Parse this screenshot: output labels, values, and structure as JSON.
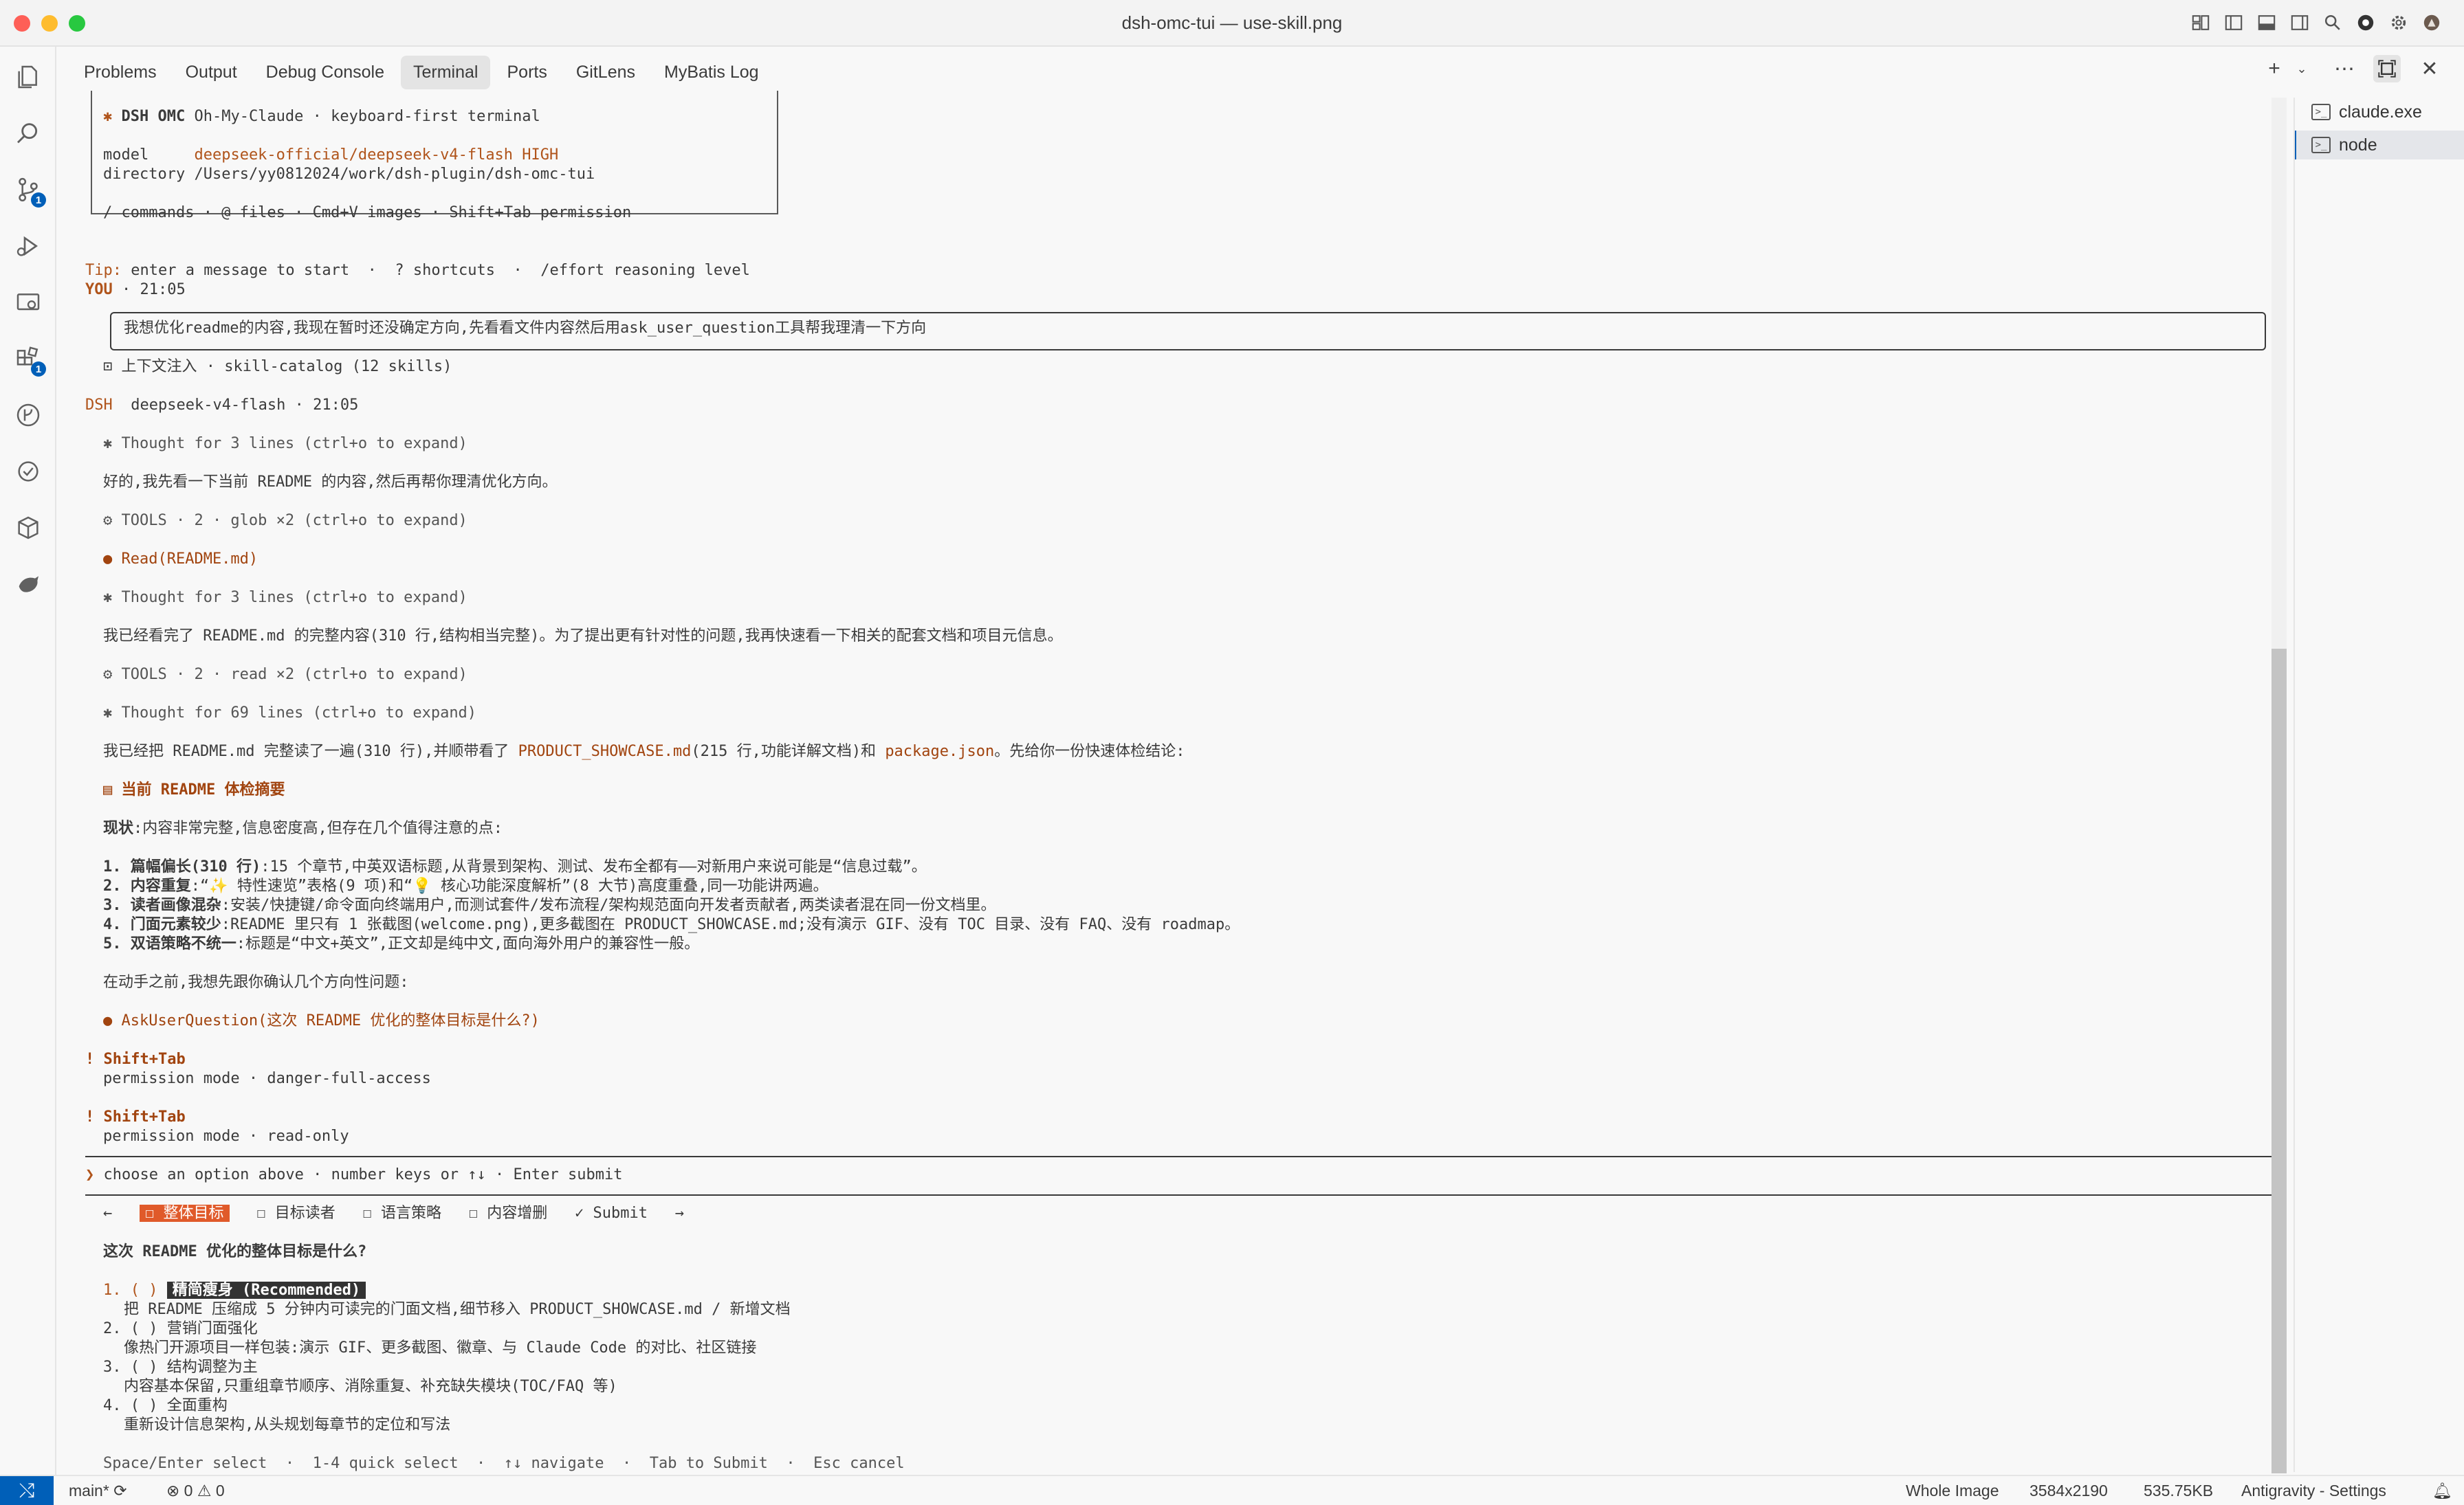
{
  "window": {
    "title": "dsh-omc-tui — use-skill.png"
  },
  "activity_bar": {
    "scm_badge": "1",
    "extensions_badge": "1"
  },
  "panel": {
    "tabs": [
      "Problems",
      "Output",
      "Debug Console",
      "Terminal",
      "Ports",
      "GitLens",
      "MyBatis Log"
    ],
    "active_tab": "Terminal"
  },
  "terminals": [
    {
      "label": "claude.exe",
      "active": false
    },
    {
      "label": "node",
      "active": true
    }
  ],
  "term": {
    "brand_star": "✱",
    "brand_name": "DSH OMC",
    "brand_sub": "Oh-My-Claude · keyboard-first terminal",
    "model_key": "model",
    "model_val": "deepseek-official/deepseek-v4-flash HIGH",
    "dir_key": "directory",
    "dir_val": "/Users/yy0812024/work/dsh-plugin/dsh-omc-tui",
    "hint": "/ commands · @ files · Cmd+V images · Shift+Tab permission",
    "tip_label": "Tip:",
    "tip_text": " enter a message to start  ·  ? shortcuts  ·  /effort reasoning level",
    "you_label": "YOU",
    "you_time": " · 21:05",
    "user_msg": "我想优化readme的内容,我现在暂时还没确定方向,先看看文件内容然后用ask_user_question工具帮我理清一下方向",
    "ctx_inject": "⊡ 上下文注入 · skill-catalog (12 skills)",
    "dsh_label": "DSH",
    "dsh_model": "  deepseek-v4-flash · 21:05",
    "thought1": "✱ Thought for 3 lines (ctrl+o to expand)",
    "resp1": "好的,我先看一下当前 README 的内容,然后再帮你理清优化方向。",
    "tools1": "⚙ TOOLS · 2 · glob ×2 (ctrl+o to expand)",
    "read_call": "● Read(README.md)",
    "thought2": "✱ Thought for 3 lines (ctrl+o to expand)",
    "resp2": "我已经看完了 README.md 的完整内容(310 行,结构相当完整)。为了提出更有针对性的问题,我再快速看一下相关的配套文档和项目元信息。",
    "tools2": "⚙ TOOLS · 2 · read ×2 (ctrl+o to expand)",
    "thought3": "✱ Thought for 69 lines (ctrl+o to expand)",
    "resp3_a": "我已经把 README.md 完整读了一遍(310 行),并顺带看了 ",
    "resp3_b": "PRODUCT_SHOWCASE.md",
    "resp3_c": "(215 行,功能详解文档)和 ",
    "resp3_d": "package.json",
    "resp3_e": "。先给你一份快速体检结论:",
    "summary_heading": "▤ 当前 README 体检摘要",
    "status_label": "现状",
    "status_text": ":内容非常完整,信息密度高,但存在几个值得注意的点:",
    "points": [
      {
        "num": "1.",
        "title": "篇幅偏长(310 行)",
        "text": ":15 个章节,中英双语标题,从背景到架构、测试、发布全都有——对新用户来说可能是“信息过载”。"
      },
      {
        "num": "2.",
        "title": "内容重复",
        "text": ":“✨ 特性速览”表格(9 项)和“💡 核心功能深度解析”(8 大节)高度重叠,同一功能讲两遍。"
      },
      {
        "num": "3.",
        "title": "读者画像混杂",
        "text": ":安装/快捷键/命令面向终端用户,而测试套件/发布流程/架构规范面向开发者贡献者,两类读者混在同一份文档里。"
      },
      {
        "num": "4.",
        "title": "门面元素较少",
        "text": ":README 里只有 1 张截图(welcome.png),更多截图在 PRODUCT_SHOWCASE.md;没有演示 GIF、没有 TOC 目录、没有 FAQ、没有 roadmap。"
      },
      {
        "num": "5.",
        "title": "双语策略不统一",
        "text": ":标题是“中文+英文”,正文却是纯中文,面向海外用户的兼容性一般。"
      }
    ],
    "pre_ask": "在动手之前,我想先跟你确认几个方向性问题:",
    "ask_call": "● AskUserQuestion(这次 README 优化的整体目标是什么?)",
    "perm1_key": "! Shift+Tab",
    "perm1_val": "permission mode · danger-full-access",
    "perm2_key": "! Shift+Tab",
    "perm2_val": "permission mode · read-only",
    "prompt_arrow": "❯",
    "prompt_text": " choose an option above · number keys or ↑↓ · Enter submit",
    "nav_left": "←",
    "q_tabs": [
      "☐ 整体目标",
      "☐ 目标读者",
      "☐ 语言策略",
      "☐ 内容增删",
      "✓ Submit"
    ],
    "nav_right": "→",
    "question": "这次 README 优化的整体目标是什么?",
    "options": [
      {
        "num": "1. ( )",
        "title": "精简瘦身 (Recommended)",
        "desc": "把 README 压缩成 5 分钟内可读完的门面文档,细节移入 PRODUCT_SHOWCASE.md / 新增文档"
      },
      {
        "num": "2. ( )",
        "title": "营销门面强化",
        "desc": "像热门开源项目一样包装:演示 GIF、更多截图、徽章、与 Claude Code 的对比、社区链接"
      },
      {
        "num": "3. ( )",
        "title": "结构调整为主",
        "desc": "内容基本保留,只重组章节顺序、消除重复、补充缺失模块(TOC/FAQ 等)"
      },
      {
        "num": "4. ( )",
        "title": "全面重构",
        "desc": "重新设计信息架构,从头规划每章节的定位和写法"
      }
    ],
    "footer_hint": "Space/Enter select  ·  1-4 quick select  ·  ↑↓ navigate  ·  Tab to Submit  ·  Esc cancel"
  },
  "status": {
    "branch": "main*",
    "errors": "0",
    "warnings": "0",
    "view_mode": "Whole Image",
    "dimensions": "3584x2190",
    "filesize": "535.75KB",
    "settings": "Antigravity - Settings"
  },
  "colors": {
    "accent": "#005fb8",
    "terminal_orange": "#b0541b",
    "selected_tab": "#e05a2a"
  }
}
